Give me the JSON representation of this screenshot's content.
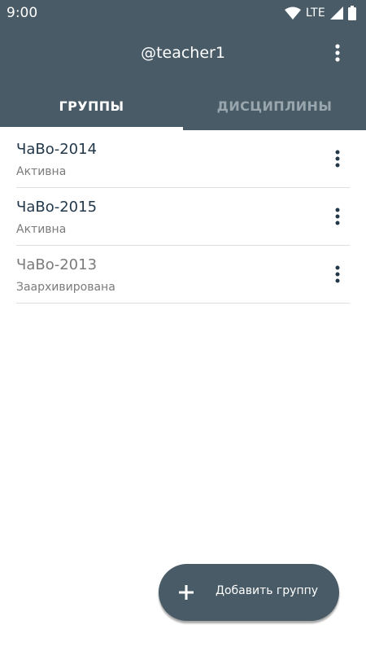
{
  "status_bar": {
    "time": "9:00",
    "network": "LTE"
  },
  "toolbar": {
    "title": "@teacher1",
    "overflow_icon": "more-vert-icon"
  },
  "tabs": [
    {
      "label": "ГРУППЫ",
      "active": true
    },
    {
      "label": "ДИСЦИПЛИНЫ",
      "active": false
    }
  ],
  "groups": [
    {
      "name": "ЧаВо-2014",
      "status": "Активна",
      "archived": false
    },
    {
      "name": "ЧаВо-2015",
      "status": "Активна",
      "archived": false
    },
    {
      "name": "ЧаВо-2013",
      "status": "Заархивирована",
      "archived": true
    }
  ],
  "fab": {
    "label": "Добавить группу",
    "icon": "plus-icon"
  },
  "colors": {
    "primary": "#485b66",
    "title_text": "#22384a",
    "secondary_text": "#7b7b7b",
    "inactive_tab": "#9aa6ad"
  }
}
